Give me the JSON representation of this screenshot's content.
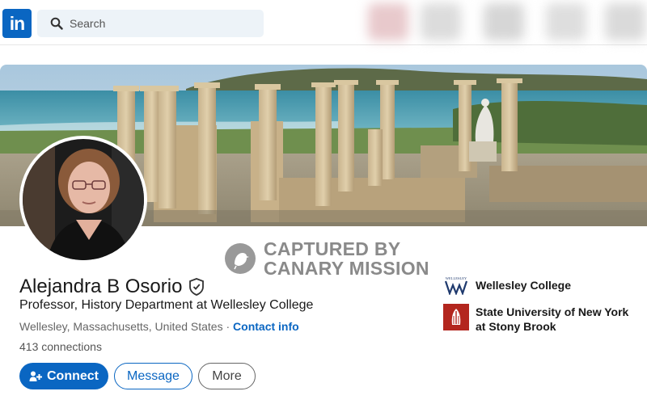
{
  "nav": {
    "logo_text": "in",
    "search_placeholder": "Search"
  },
  "watermark": {
    "line1": "CAPTURED BY",
    "line2": "CANARY MISSION"
  },
  "profile": {
    "name": "Alejandra B Osorio",
    "headline": "Professor, History Department at Wellesley College",
    "location": "Wellesley, Massachusetts, United States",
    "separator": "·",
    "contact_info": "Contact info",
    "connections": "413 connections"
  },
  "actions": {
    "connect": "Connect",
    "message": "Message",
    "more": "More"
  },
  "education": [
    {
      "name": "Wellesley College",
      "logo_text": "WELLESLEY"
    },
    {
      "name": "State University of New York at Stony Brook"
    }
  ],
  "colors": {
    "brand": "#0a66c2",
    "stony_brook_red": "#b3261e"
  }
}
